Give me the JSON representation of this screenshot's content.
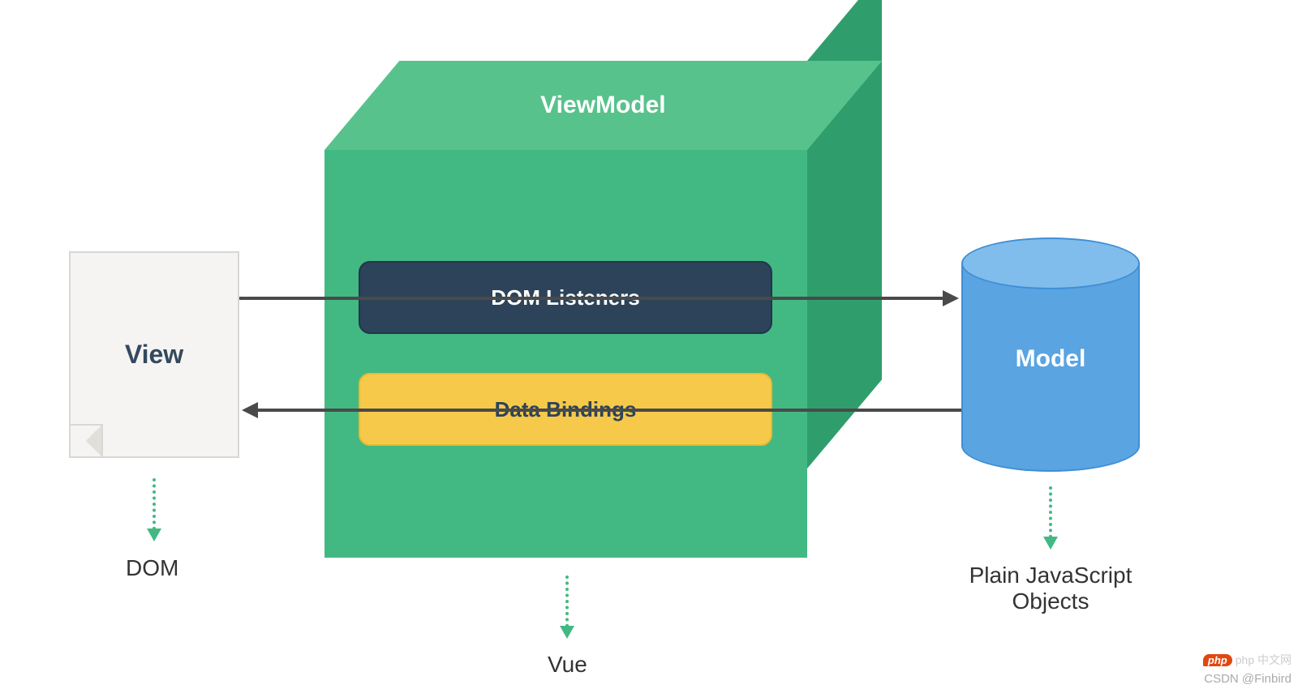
{
  "view": {
    "title": "View",
    "caption": "DOM"
  },
  "viewmodel": {
    "title": "ViewModel",
    "listeners_label": "DOM Listeners",
    "bindings_label": "Data Bindings",
    "caption": "Vue"
  },
  "model": {
    "title": "Model",
    "caption": "Plain JavaScript Objects"
  },
  "colors": {
    "cube_front": "#42b983",
    "cube_top": "#58c28c",
    "cube_side": "#2f9e6c",
    "pill_dark": "#2c435a",
    "pill_gold": "#f6c94a",
    "cylinder": "#5aa4e2",
    "cylinder_top": "#81bdec",
    "arrow": "#4a4a4a",
    "accent": "#42b983"
  },
  "watermark": {
    "line1": "php 中文网",
    "badge": "php",
    "line2": "CSDN @Finbird"
  }
}
